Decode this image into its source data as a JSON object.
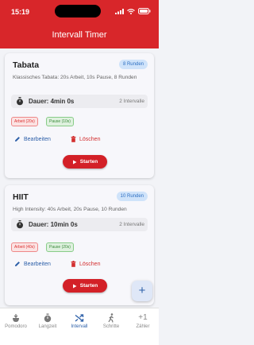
{
  "status": {
    "time": "15:19"
  },
  "app": {
    "title": "Intervall Timer"
  },
  "timers": [
    {
      "name": "Tabata",
      "rounds_badge": "8 Runden",
      "description": "Klassisches Tabata: 20s Arbeit, 10s Pause, 8 Runden",
      "duration": "Dauer: 4min 0s",
      "intervals": "2 Intervalle",
      "chips": [
        "Arbeit (20s)",
        "Pause (10s)"
      ]
    },
    {
      "name": "HIIT",
      "rounds_badge": "10 Runden",
      "description": "High Intensity: 40s Arbeit, 20s Pause, 10 Runden",
      "duration": "Dauer: 10min 0s",
      "intervals": "2 Intervalle",
      "chips": [
        "Arbeit (40s)",
        "Pause (20s)"
      ]
    }
  ],
  "actions": {
    "edit": "Bearbeiten",
    "delete": "Löschen",
    "start": "Starten"
  },
  "fab": {
    "label": "+"
  },
  "nav": [
    {
      "label": "Pomodoro",
      "icon": "pomodoro-icon"
    },
    {
      "label": "Langzeit",
      "icon": "stopwatch-icon"
    },
    {
      "label": "Intervall",
      "icon": "shuffle-icon",
      "active": true
    },
    {
      "label": "Schritte",
      "icon": "walking-icon"
    },
    {
      "label": "Zähler",
      "icon": "plus-one-icon",
      "glyph": "+1"
    }
  ],
  "colors": {
    "primary": "#d8262a",
    "accent": "#2c5fa8"
  }
}
